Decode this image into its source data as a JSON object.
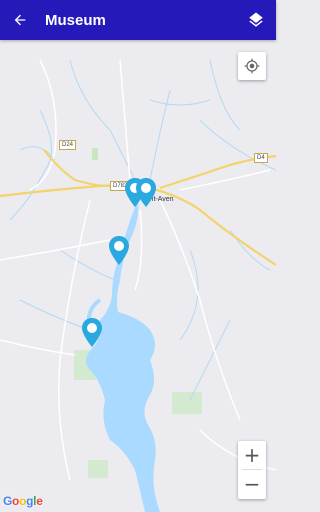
{
  "appbar": {
    "title": "Museum",
    "back_icon": "arrow-back-icon",
    "layers_icon": "layers-icon",
    "color": "#2619b9"
  },
  "map": {
    "road_labels": [
      "D24",
      "D783",
      "D4"
    ],
    "place_label": "Pont-Aven",
    "markers_count": 4,
    "marker_color": "#29a9e0",
    "water_color": "#aadaff",
    "road_color": "#f3d36b"
  },
  "controls": {
    "locate_icon": "my-location-icon",
    "zoom_in": "+",
    "zoom_out": "−"
  },
  "attribution": "Google"
}
